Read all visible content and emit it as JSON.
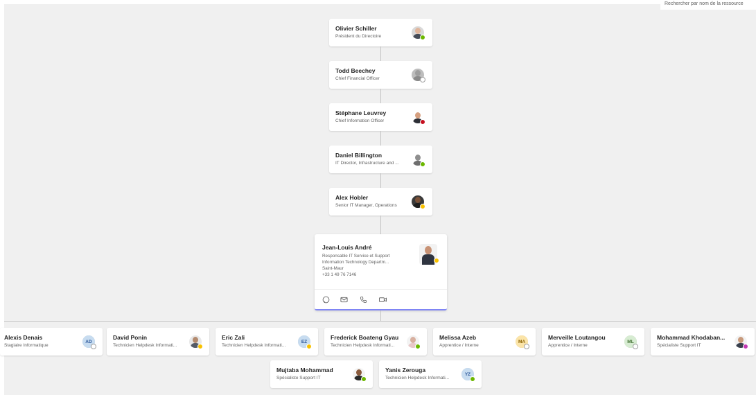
{
  "corner_text": "Rechercher par nom de la ressource",
  "chain": [
    {
      "name": "Olivier Schiller",
      "title": "Président du Directoire",
      "presence": "available"
    },
    {
      "name": "Todd Beechey",
      "title": "Chief Financial Officer",
      "presence": "offline"
    },
    {
      "name": "Stéphane Leuvrey",
      "title": "Chief Information Officer",
      "presence": "busy"
    },
    {
      "name": "Daniel Billington",
      "title": "IT Director, Infrastructure and ...",
      "presence": "available"
    },
    {
      "name": "Alex Hobler",
      "title": "Senior IT Manager, Operations",
      "presence": "away"
    }
  ],
  "selected_person": {
    "name": "Jean-Louis André",
    "title": "Responsable IT Service et Support",
    "department": "Information Technology Departm...",
    "location": "Saint-Maur",
    "phone": "+33 1 49 76 7146",
    "presence": "away",
    "actions": [
      "chat-icon",
      "mail-icon",
      "phone-icon",
      "video-icon"
    ]
  },
  "reports": [
    {
      "name": "Alexis Denais",
      "title": "Stagiaire Informatique",
      "initials": "AD",
      "avatar_bg": "#c7dcf0",
      "avatar_fg": "#2b579a",
      "presence": "offline"
    },
    {
      "name": "David Ponin",
      "title": "Technicien Helpdesk Informati...",
      "initials": "",
      "presence": "away"
    },
    {
      "name": "Eric Zali",
      "title": "Technicien Helpdesk Informati...",
      "initials": "EZ",
      "avatar_bg": "#c7dcf0",
      "avatar_fg": "#2b579a",
      "presence": "away"
    },
    {
      "name": "Frederick Boateng Gyau",
      "title": "Technicien Helpdesk Informati...",
      "initials": "",
      "presence": "available"
    },
    {
      "name": "Melissa Azeb",
      "title": "Apprentice / Interne",
      "initials": "MA",
      "avatar_bg": "#fbe4a8",
      "avatar_fg": "#8a6100",
      "presence": "offline"
    },
    {
      "name": "Merveille Loutangou",
      "title": "Apprentice / Interne",
      "initials": "ML",
      "avatar_bg": "#d7ecd2",
      "avatar_fg": "#3f6e2f",
      "presence": "offline"
    },
    {
      "name": "Mohammad Khodaban...",
      "title": "Spécialiste Support IT",
      "initials": "",
      "presence": "dnd-purple"
    },
    {
      "name": "Mujtaba Mohammad",
      "title": "Spécialiste Support IT",
      "initials": "",
      "presence": "available"
    },
    {
      "name": "Yanis Zerouga",
      "title": "Technicien Helpdesk Informati...",
      "initials": "YZ",
      "avatar_bg": "#c7dcf0",
      "avatar_fg": "#2b579a",
      "presence": "available"
    }
  ]
}
